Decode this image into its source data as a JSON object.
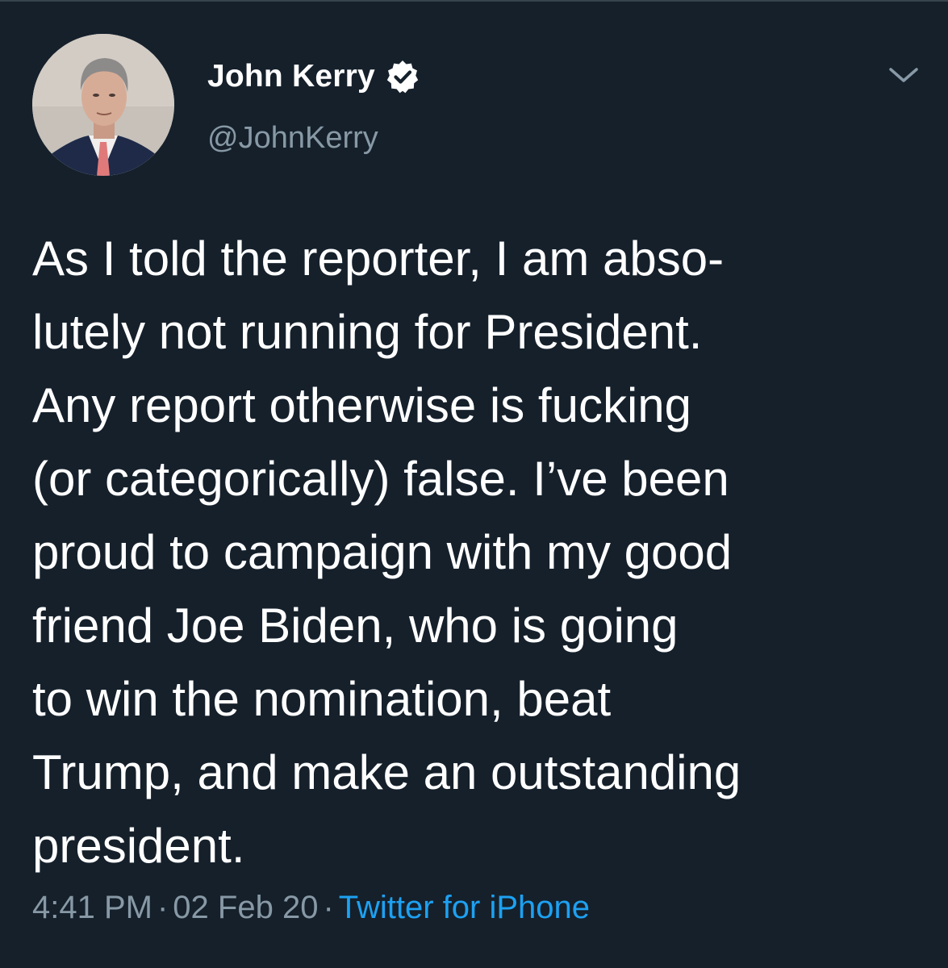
{
  "author": {
    "display_name": "John Kerry",
    "handle": "@JohnKerry",
    "verified": true,
    "avatar_icon": "person-photo-avatar"
  },
  "menu": {
    "icon": "chevron-down-icon"
  },
  "tweet": {
    "lines": [
      "As I told the reporter, I am abso-",
      "lutely not running for President.",
      "Any report otherwise is fucking",
      "(or categorically) false. I’ve been",
      "proud to campaign with my good",
      "friend Joe Biden, who is going",
      "to win the nomination, beat",
      "Trump, and make an outstanding",
      "president."
    ]
  },
  "meta": {
    "time": "4:41 PM",
    "separator": "·",
    "date": "02 Feb 20",
    "source": "Twitter for iPhone"
  },
  "colors": {
    "background": "#15202b",
    "text": "#ffffff",
    "secondary_text": "#8899a6",
    "link": "#1da1f2"
  }
}
